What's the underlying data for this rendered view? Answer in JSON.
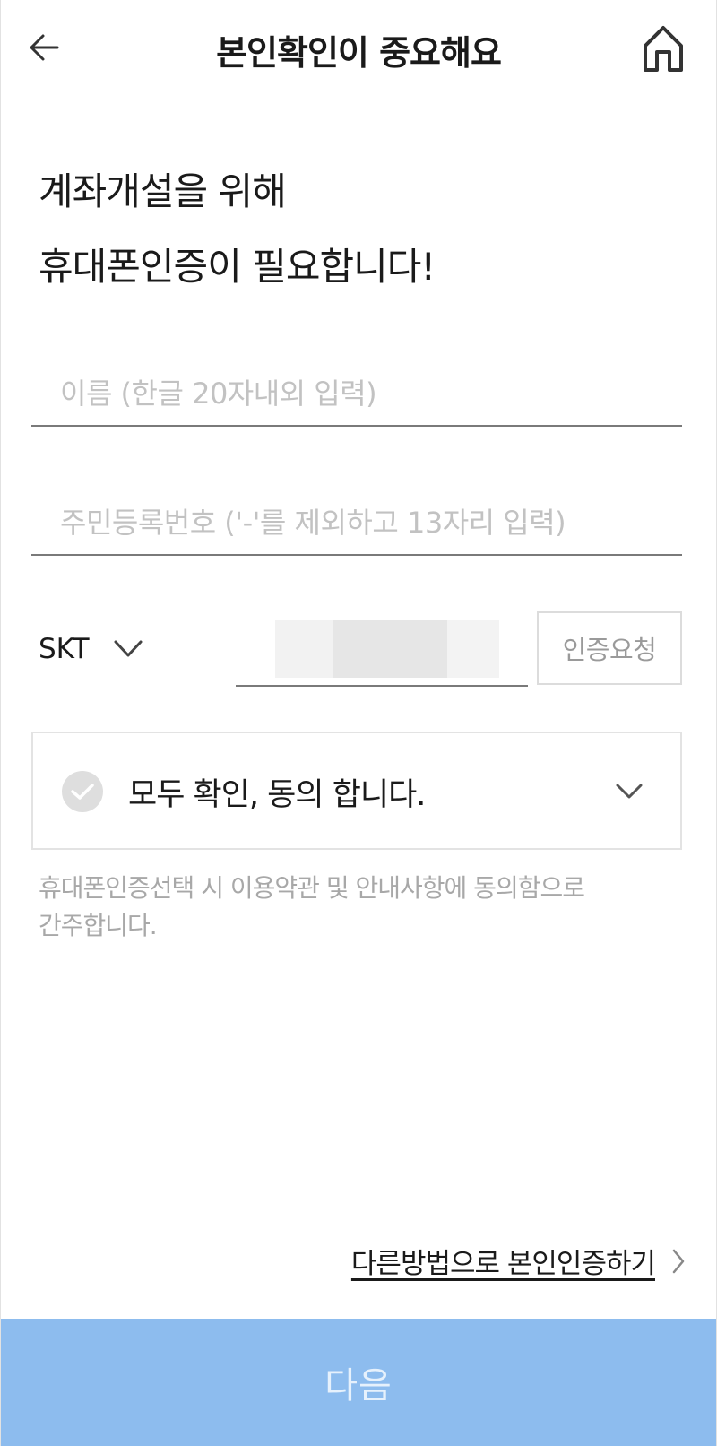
{
  "header": {
    "title": "본인확인이 중요해요",
    "back_icon": "arrow-left-icon",
    "home_icon": "home-icon"
  },
  "headline": {
    "line1": "계좌개설을 위해",
    "line2": "휴대폰인증이 필요합니다!"
  },
  "form": {
    "name_placeholder": "이름 (한글 20자내외 입력)",
    "name_value": "",
    "rrn_placeholder": "주민등록번호 ('-'를 제외하고 13자리 입력)",
    "rrn_value": "",
    "carrier_selected": "SKT",
    "phone_value": "",
    "request_button": "인증요청"
  },
  "agreement": {
    "label": "모두 확인, 동의 합니다.",
    "checked": false,
    "notice": "휴대폰인증선택 시 이용약관 및 안내사항에 동의함으로 간주합니다."
  },
  "other_method": {
    "label": "다른방법으로 본인인증하기"
  },
  "next_button": {
    "label": "다음"
  },
  "colors": {
    "primary_disabled": "#8dbcee",
    "check_inactive": "#dedede",
    "placeholder": "#c2c2c2"
  }
}
